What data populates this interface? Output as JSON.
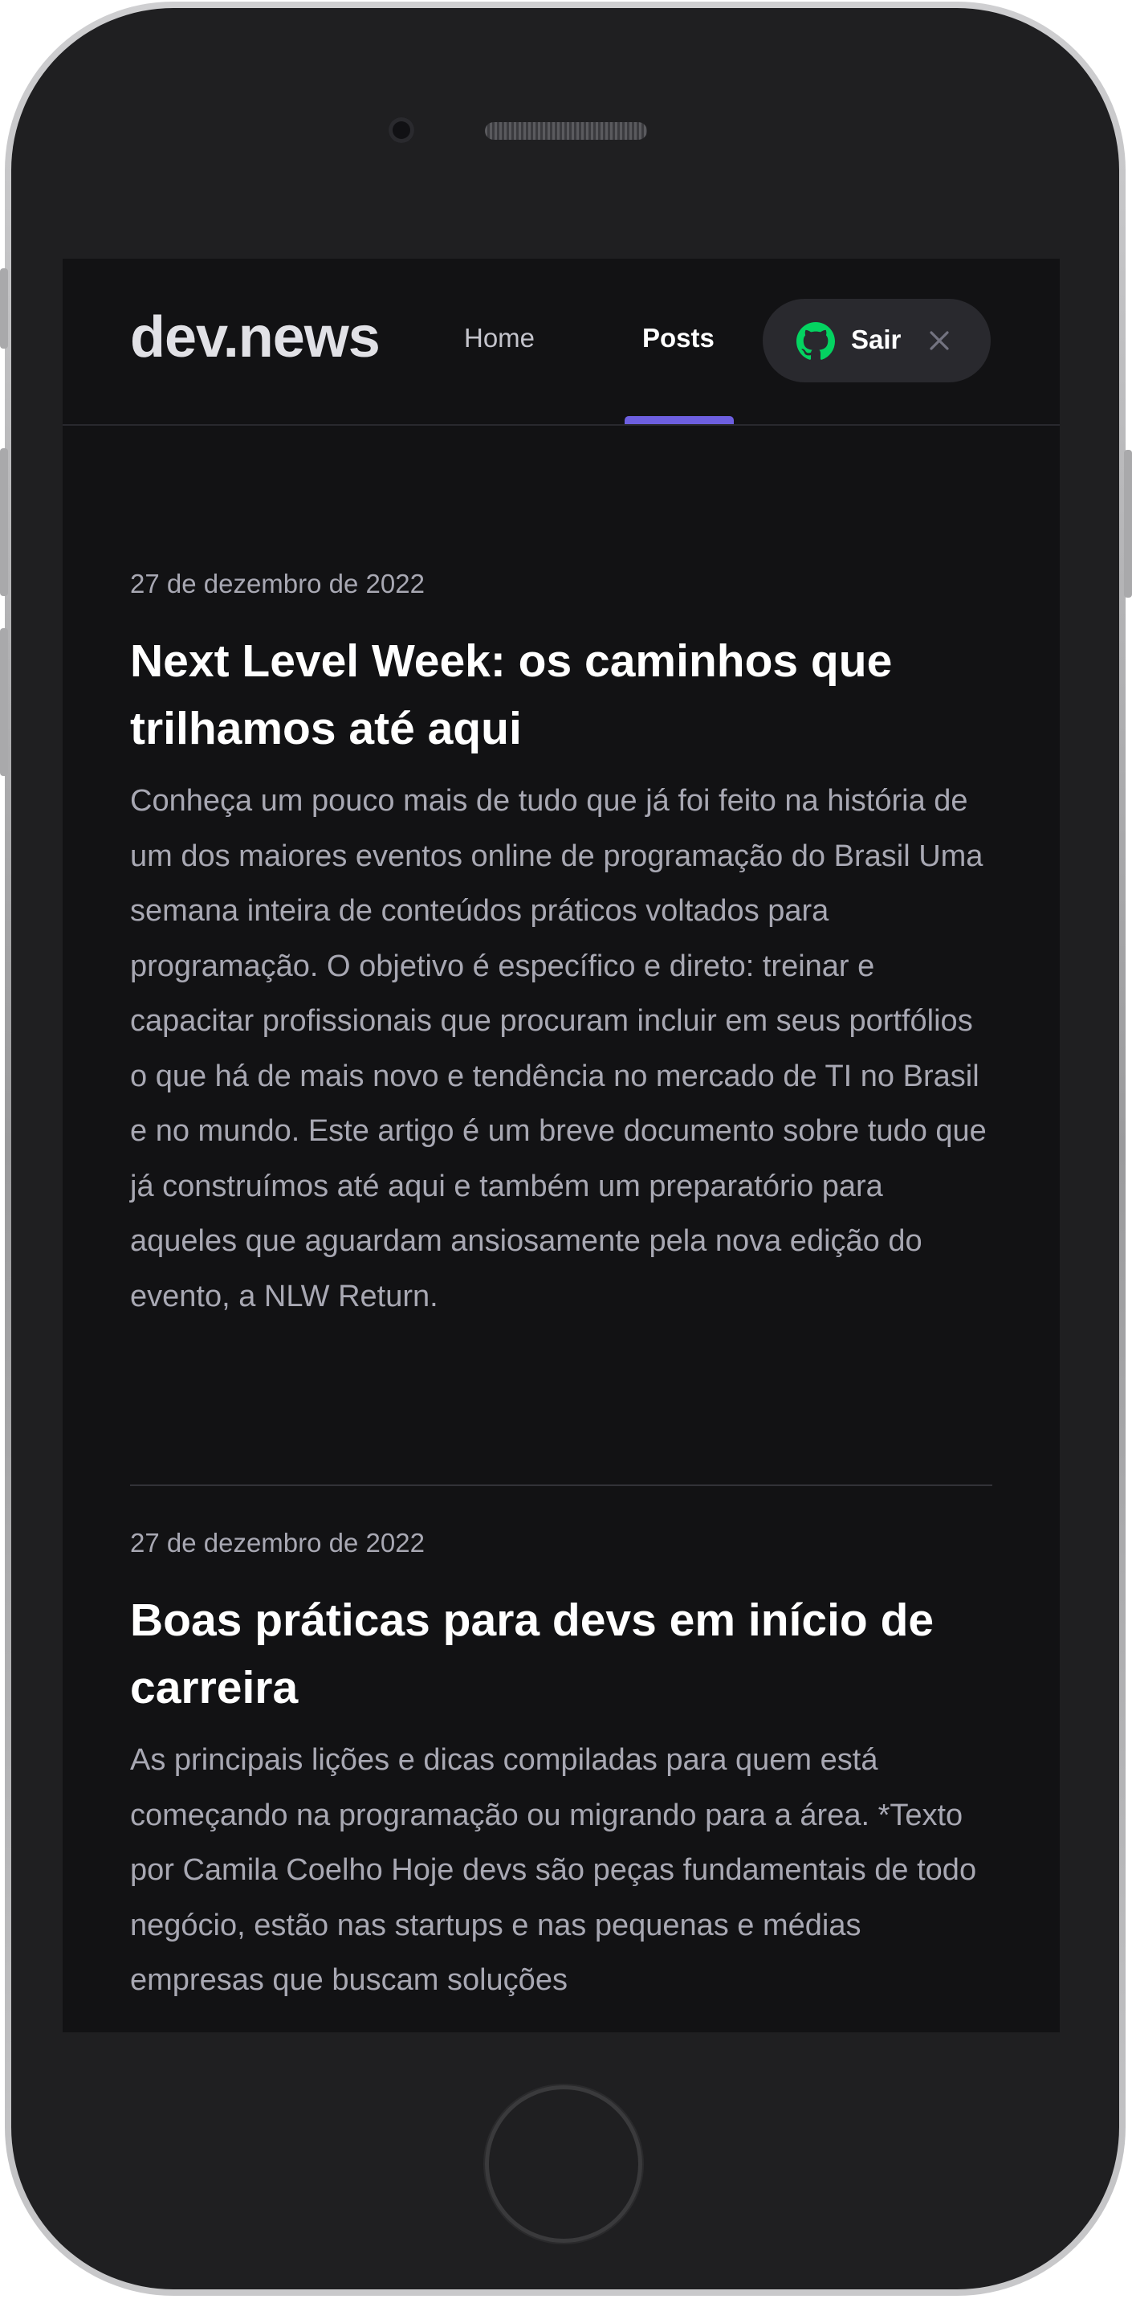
{
  "header": {
    "logo": "dev.news",
    "nav": {
      "home_label": "Home",
      "posts_label": "Posts"
    },
    "signout_label": "Sair"
  },
  "posts": [
    {
      "date": "27 de dezembro de 2022",
      "title": "Next Level Week: os caminhos que trilhamos até aqui",
      "excerpt": "Conheça um pouco mais de tudo que já foi feito na história de um dos maiores eventos online de programação do Brasil Uma semana inteira de conteúdos práticos voltados para programação. O objetivo é específico e direto: treinar e capacitar profissionais que procuram incluir em seus portfólios o que há de mais novo e tendência no mercado de TI no Brasil e no mundo. Este artigo é um breve documento sobre tudo que já construímos até aqui e também um preparatório para aqueles que aguardam ansiosamente pela nova edição do evento, a NLW Return."
    },
    {
      "date": "27 de dezembro de 2022",
      "title": "Boas práticas para devs em início de carreira",
      "excerpt": "As principais lições e dicas compiladas para quem está começando na programação ou migrando para a área. *Texto por Camila Coelho Hoje devs são peças fundamentais de todo negócio, estão nas startups e nas pequenas e médias empresas que buscam soluções"
    }
  ],
  "colors": {
    "background": "#121214",
    "accent": "#6d5fe0",
    "github_icon": "#04d361",
    "text_primary": "#ffffff",
    "text_secondary": "#a8a8b3"
  },
  "icons": {
    "github": "github-icon",
    "close": "close-icon"
  }
}
